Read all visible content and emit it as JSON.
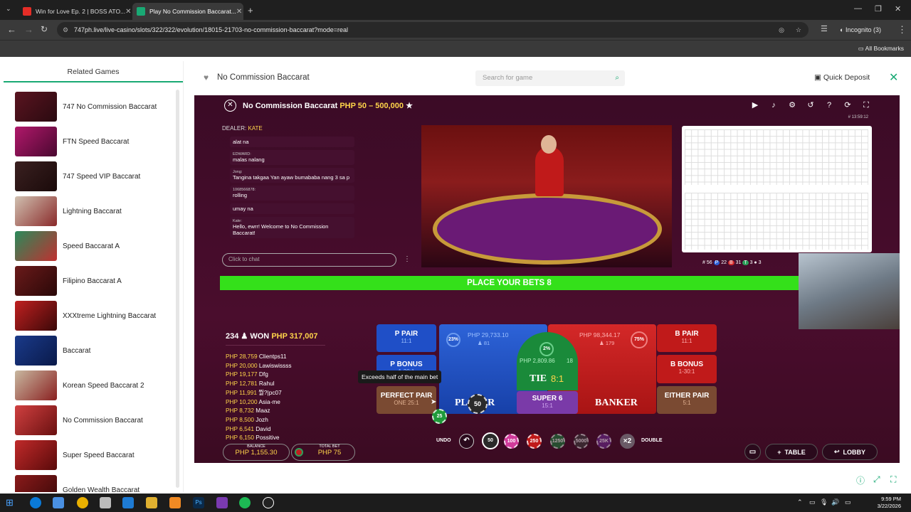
{
  "browser": {
    "tabs": [
      {
        "title": "Win for Love Ep. 2 | BOSS ATO..."
      },
      {
        "title": "Play No Commission Baccarat..."
      }
    ],
    "url": "747ph.live/live-casino/slots/322/322/evolution/18015-21703-no-commission-baccarat?mode=real",
    "profile": "Incognito (3)",
    "bookmarks_label": "All Bookmarks"
  },
  "sidebar": {
    "title": "Related Games",
    "games": [
      {
        "name": "747 No Commission Baccarat"
      },
      {
        "name": "FTN Speed Baccarat"
      },
      {
        "name": "747 Speed VIP Baccarat"
      },
      {
        "name": "Lightning Baccarat"
      },
      {
        "name": "Speed Baccarat A"
      },
      {
        "name": "Filipino Baccarat A"
      },
      {
        "name": "XXXtreme Lightning Baccarat"
      },
      {
        "name": "Baccarat"
      },
      {
        "name": "Korean Speed Baccarat 2"
      },
      {
        "name": "No Commission Baccarat"
      },
      {
        "name": "Super Speed Baccarat"
      },
      {
        "name": "Golden Wealth Baccarat"
      }
    ]
  },
  "header": {
    "game_title": "No Commission Baccarat",
    "search_placeholder": "Search for game",
    "quick_deposit": "Quick Deposit"
  },
  "game": {
    "title": "No Commission Baccarat",
    "range": "PHP 50 – 500,000",
    "time": "# 13:59:12",
    "dealer_label": "DEALER:",
    "dealer_name": "KATE",
    "chat": [
      {
        "user": "",
        "text": "alat na"
      },
      {
        "user": "EDWARD:",
        "text": "malas nalang"
      },
      {
        "user": "Jong:",
        "text": "Tangina takgaa Yan ayaw bumababa nang 3 sa p"
      },
      {
        "user": "1068566878:",
        "text": "rolling"
      },
      {
        "user": "",
        "text": "umay na"
      },
      {
        "user": "Kate:",
        "text": "Hello, ewrr! Welcome to No Commission Baccarat!"
      }
    ],
    "chat_placeholder": "Click to chat",
    "stats": {
      "rounds": "# 56",
      "player": "22",
      "banker": "31",
      "tie": "3",
      "other": "3"
    },
    "bets_banner": "PLACE YOUR BETS 8",
    "winners_count": "234",
    "won_label": "WON",
    "won_amount": "PHP 317,007",
    "winners": [
      {
        "amount": "PHP 28,759",
        "name": "Clientps11"
      },
      {
        "amount": "PHP 20,000",
        "name": "Lawiswissss"
      },
      {
        "amount": "PHP 19,177",
        "name": "Dfg"
      },
      {
        "amount": "PHP 12,781",
        "name": "Rahul"
      },
      {
        "amount": "PHP 11,991",
        "name": "뭘?|pc07"
      },
      {
        "amount": "PHP 10,200",
        "name": "Asia-me"
      },
      {
        "amount": "PHP 8,732",
        "name": "Maaz"
      },
      {
        "amount": "PHP 8,500",
        "name": "Jozh"
      },
      {
        "amount": "PHP 6,541",
        "name": "David"
      },
      {
        "amount": "PHP 6,150",
        "name": "Possitive"
      }
    ],
    "balance_label": "BALANCE",
    "balance": "PHP 1,155.30",
    "total_bet_label": "TOTAL BET",
    "total_bet": "PHP 75",
    "bets": {
      "p_pair": {
        "label": "P PAIR",
        "odds": "11:1"
      },
      "p_bonus": {
        "label": "P BONUS",
        "odds": "1-30:1"
      },
      "perfect_pair": {
        "label": "PERFECT PAIR",
        "odds": "ONE 25:1"
      },
      "player": {
        "label": "PLAYER",
        "amount": "PHP 29,733.10",
        "count": "81",
        "pct": "23%"
      },
      "tie": {
        "label": "TIE",
        "odds": "8:1",
        "amount": "PHP 2,809.86",
        "count": "18",
        "pct": "2%"
      },
      "super6": {
        "label": "SUPER 6",
        "odds": "15:1"
      },
      "banker": {
        "label": "BANKER",
        "amount": "PHP 98,344.17",
        "count": "179",
        "pct": "75%"
      },
      "b_pair": {
        "label": "B PAIR",
        "odds": "11:1"
      },
      "b_bonus": {
        "label": "B BONUS",
        "odds": "1-30:1"
      },
      "either_pair": {
        "label": "EITHER PAIR",
        "odds": "5:1"
      }
    },
    "tooltip": "Exceeds half of the main bet",
    "placed_chip": "50",
    "placed_chip_small": "25",
    "undo": "UNDO",
    "double": "DOUBLE",
    "double_icon": "×2",
    "chips": [
      "50",
      "100",
      "250",
      "1250",
      "5000",
      "25K"
    ],
    "table_btn": "TABLE",
    "lobby_btn": "LOBBY"
  },
  "taskbar": {
    "time": "9:59 PM",
    "date": "3/22/2026"
  }
}
